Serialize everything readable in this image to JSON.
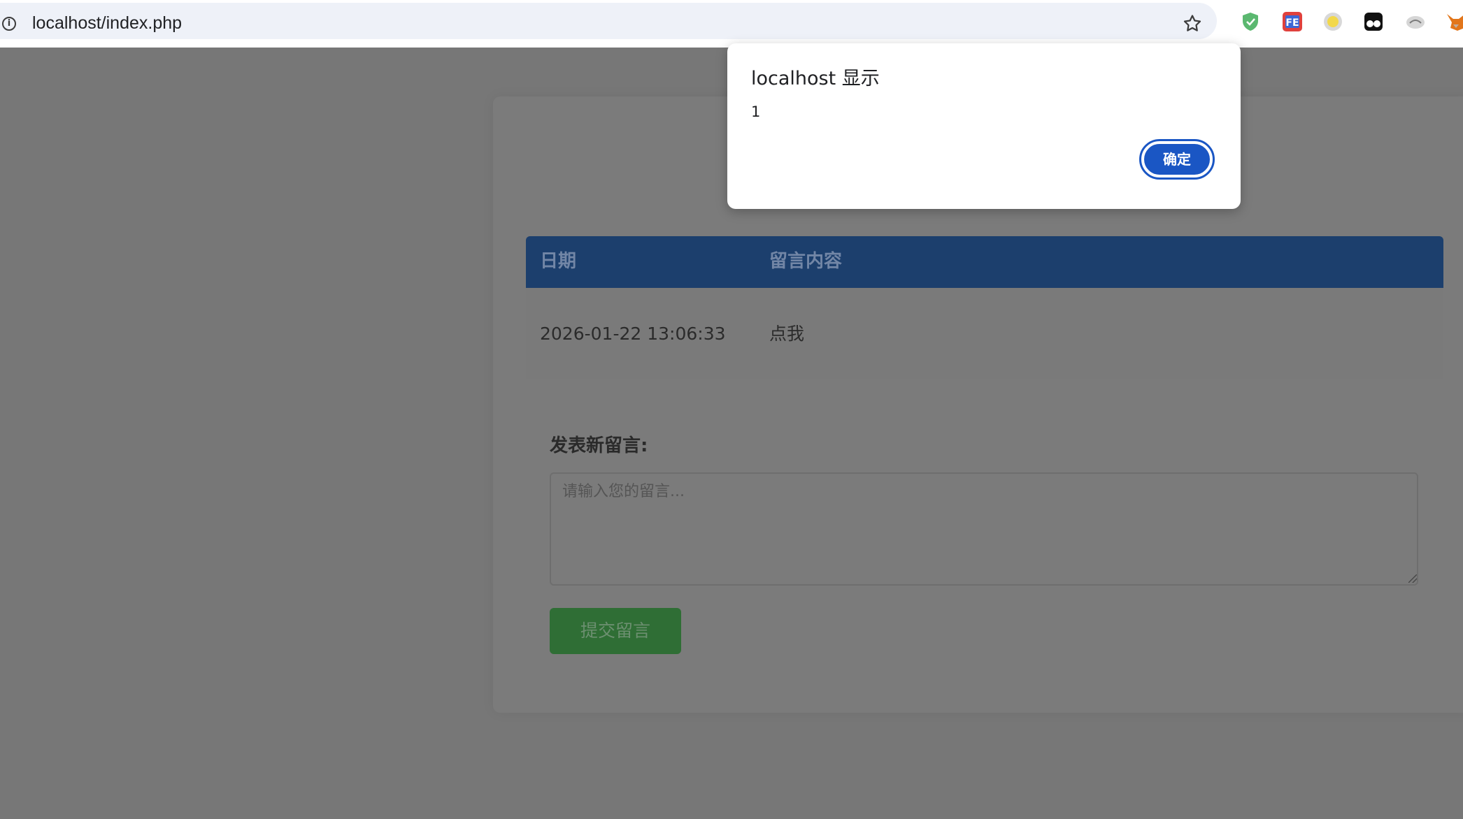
{
  "browser": {
    "info_glyph": "i",
    "url": "localhost/index.php",
    "extensions": [
      "shield-extension-icon",
      "fe-extension-icon",
      "circle-extension-icon",
      "glasses-extension-icon",
      "cloud-extension-icon",
      "fox-extension-icon"
    ]
  },
  "table": {
    "headers": [
      "日期",
      "留言内容"
    ],
    "rows": [
      {
        "date": "2026-01-22 13:06:33",
        "content": "点我"
      }
    ]
  },
  "form": {
    "label": "发表新留言:",
    "placeholder": "请输入您的留言...",
    "value": "",
    "submit_label": "提交留言"
  },
  "dialog": {
    "title": "localhost 显示",
    "message": "1",
    "ok_label": "确定"
  },
  "colors": {
    "overlay_bg": "#777777",
    "table_header": "#1c3f6d",
    "submit_green": "#2f6e35",
    "dialog_button": "#1a56c4"
  }
}
